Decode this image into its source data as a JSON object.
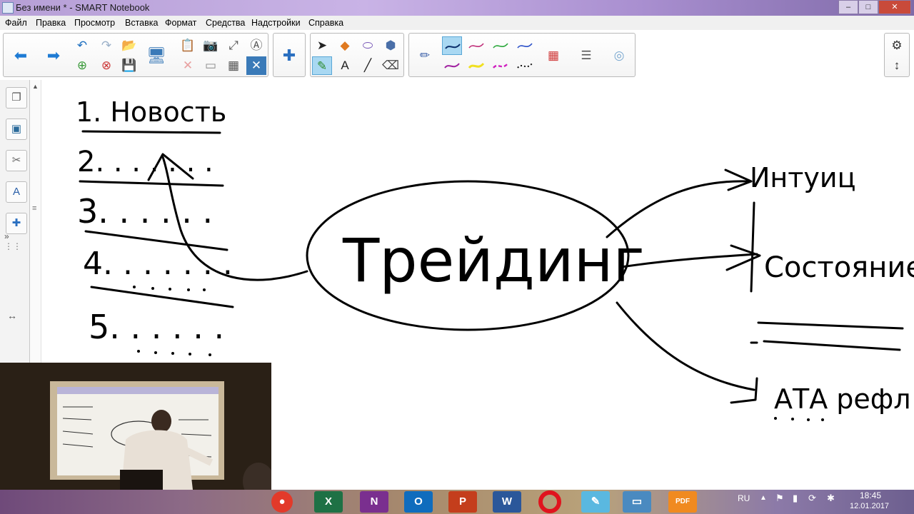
{
  "window": {
    "title": "Без имени * - SMART Notebook",
    "minimize": "–",
    "maximize": "□",
    "close": "✕"
  },
  "menu": [
    "Файл",
    "Правка",
    "Просмотр",
    "Вставка",
    "Формат",
    "Средства",
    "Надстройки",
    "Справка"
  ],
  "canvas_text": {
    "list_1": "1. Новость",
    "list_2": "2. . . . . . .",
    "list_3": "3. . . . . .",
    "list_4": "4. . . . . . .",
    "list_5": "5. . . . . .",
    "center": "Трейдинг",
    "right_1": "Интуиц",
    "right_2": "Состояние",
    "right_3": "АТА рефл"
  },
  "taskbar": {
    "apps": [
      "smartrecorder",
      "excel",
      "onenote",
      "outlook",
      "powerpoint",
      "word",
      "opera",
      "notebook",
      "screen",
      "pdf"
    ],
    "labels": {
      "excel": "X",
      "onenote": "N",
      "outlook": "O",
      "powerpoint": "P",
      "word": "W",
      "pdf": "PDF"
    },
    "lang": "RU",
    "time": "18:45",
    "date": "12.01.2017"
  },
  "colors": {
    "ink": "#000000",
    "toolbar_sel": "#a9d8f2",
    "excel": "#1e7145",
    "onenote": "#7a2f8f",
    "outlook": "#0f6cbd",
    "powerpoint": "#c43e1c",
    "word": "#2b579a",
    "opera": "#e0141e"
  }
}
